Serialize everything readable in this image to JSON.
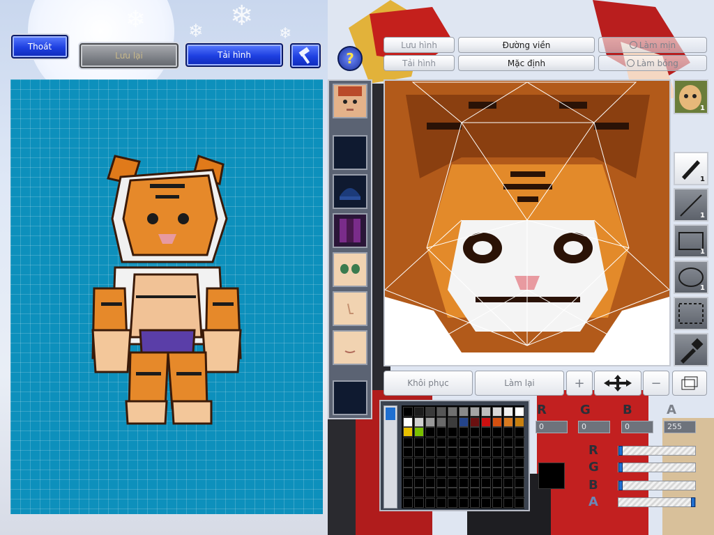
{
  "toolbar": {
    "exit_label": "Thoát",
    "save_label": "Lưu lại",
    "reload_label": "Tải hình"
  },
  "editor_tabs": {
    "save_image": "Lưu hình",
    "load_image": "Tải hình",
    "outline": "Đường viền",
    "default": "Mặc định",
    "smooth": "Làm mịn",
    "shade": "Làm bóng"
  },
  "tools": [
    {
      "name": "pen",
      "count": "1"
    },
    {
      "name": "line",
      "count": "1"
    },
    {
      "name": "rectangle",
      "count": "1"
    },
    {
      "name": "ellipse",
      "count": "1"
    },
    {
      "name": "select",
      "count": ""
    },
    {
      "name": "eyedropper",
      "count": ""
    }
  ],
  "head_thumb_count": "1",
  "bottom_buttons": {
    "restore": "Khôi phục",
    "redo": "Làm lại"
  },
  "color": {
    "r_value": "0",
    "g_value": "0",
    "b_value": "0",
    "a_value": "255",
    "current_hex": "#000000",
    "r_label": "R",
    "g_label": "G",
    "b_label": "B",
    "a_label": "A"
  },
  "palette": {
    "row1": [
      "#000000",
      "#1c1c1c",
      "#3a3a3a",
      "#565656",
      "#707070",
      "#8a8a8a",
      "#a4a4a4",
      "#bebebe",
      "#d8d8d8",
      "#f0f0f0",
      "#ffffff"
    ],
    "row2": [
      "#ffffff",
      "#d0d0d0",
      "#9a9a9a",
      "#6a6a6a",
      "#3c3c3c",
      "#24448a",
      "#6a1010",
      "#cc1010",
      "#d45010",
      "#d87a20",
      "#c88010"
    ],
    "row3": [
      "#e8c000",
      "#7ac000",
      "#000000",
      "#000000",
      "#000000",
      "#000000",
      "#000000",
      "#000000",
      "#000000",
      "#000000",
      "#000000"
    ]
  },
  "accent": {
    "panel_blue": "#0d90bc",
    "button_blue": "#1d3fe0"
  }
}
